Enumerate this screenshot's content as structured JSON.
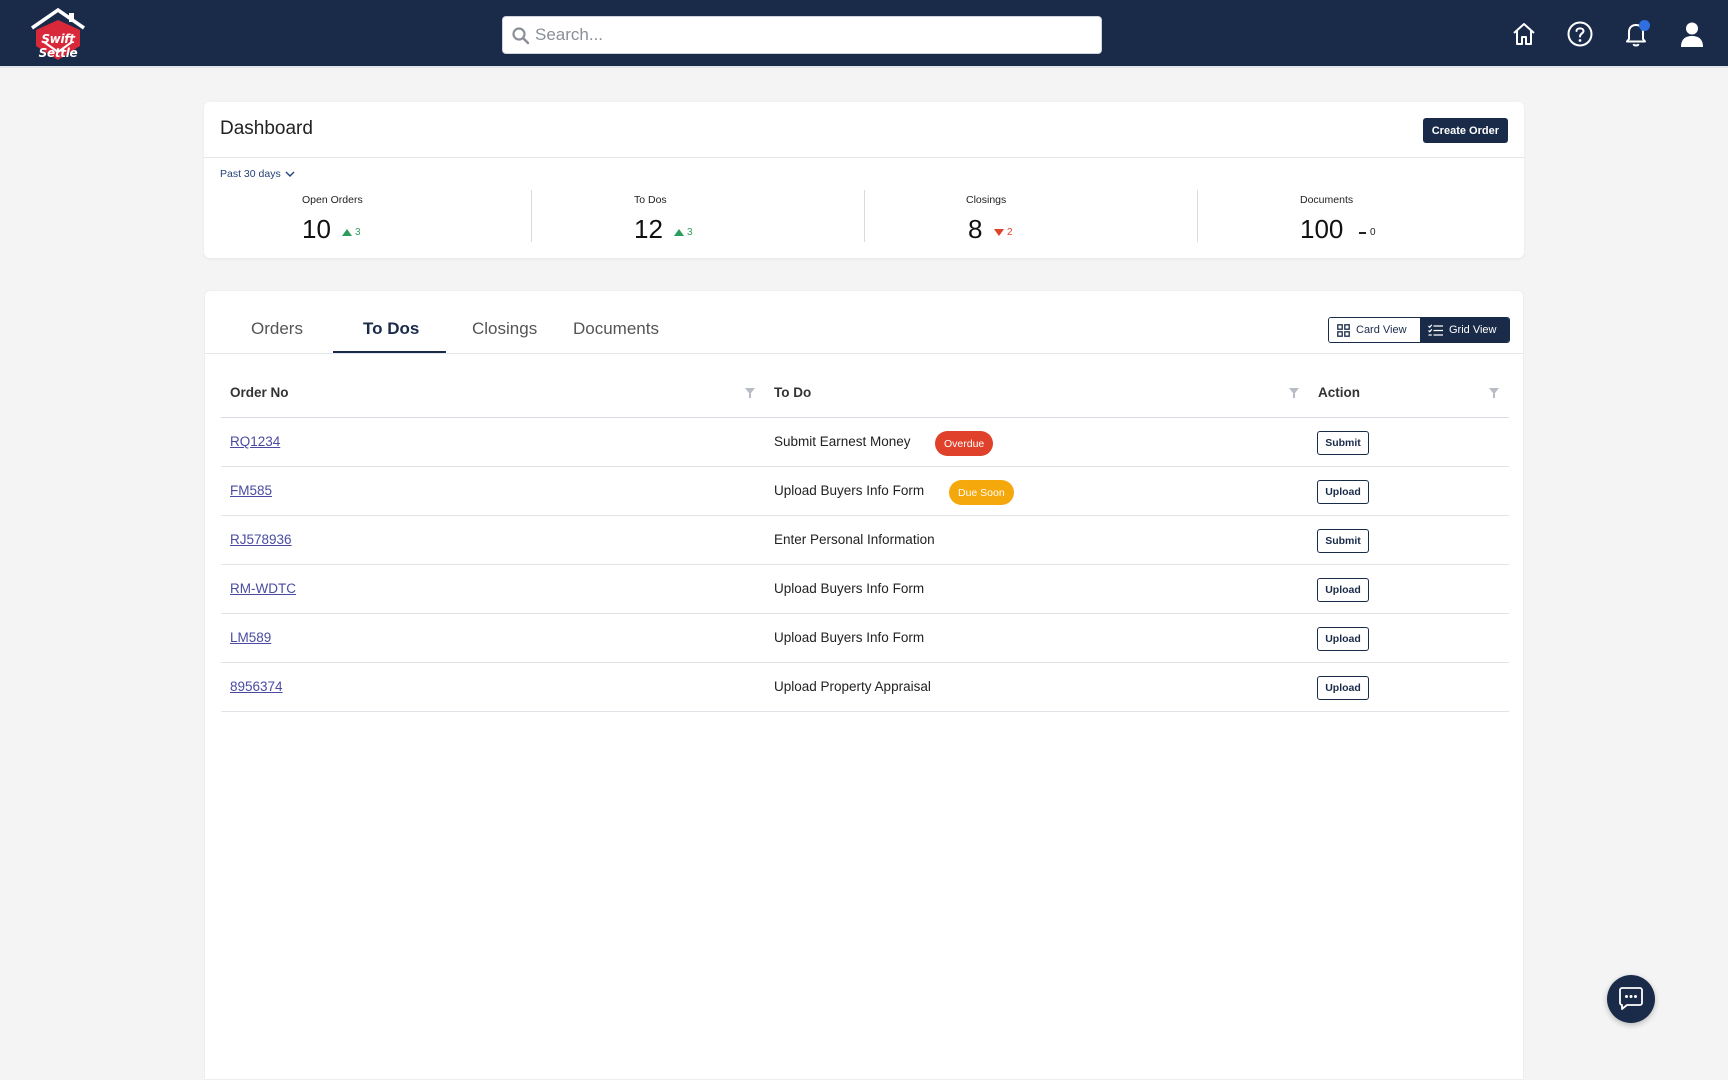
{
  "brand": {
    "name": "Swift Settle",
    "navy": "#1a2b4a",
    "accent_red": "#d8283a"
  },
  "header": {
    "search_placeholder": "Search...",
    "icons": [
      "home-icon",
      "help-icon",
      "bell-icon",
      "user-icon"
    ],
    "has_notification": true
  },
  "summary": {
    "title": "Dashboard",
    "create_label": "Create Order",
    "period_label": "Past 30 days",
    "stats": [
      {
        "label": "Open Orders",
        "value": "10",
        "delta": "3",
        "trend": "up"
      },
      {
        "label": "To Dos",
        "value": "12",
        "delta": "3",
        "trend": "up"
      },
      {
        "label": "Closings",
        "value": "8",
        "delta": "2",
        "trend": "down"
      },
      {
        "label": "Documents",
        "value": "100",
        "delta": "0",
        "trend": "flat"
      }
    ]
  },
  "tabs": [
    {
      "label": "Orders"
    },
    {
      "label": "To Dos",
      "active": true
    },
    {
      "label": "Closings"
    },
    {
      "label": "Documents"
    }
  ],
  "views": {
    "card_label": "Card View",
    "grid_label": "Grid View",
    "selected": "Grid View"
  },
  "table": {
    "columns": [
      "Order No",
      "To Do",
      "Action"
    ],
    "rows": [
      {
        "order": "RQ1234",
        "todo": "Submit Earnest Money",
        "badge": "Overdue",
        "action": "Submit"
      },
      {
        "order": "FM585",
        "todo": "Upload Buyers Info Form",
        "badge": "Due Soon",
        "action": "Upload"
      },
      {
        "order": "RJ578936",
        "todo": "Enter Personal Information",
        "badge": "",
        "action": "Submit"
      },
      {
        "order": "RM-WDTC",
        "todo": "Upload Buyers Info Form",
        "badge": "",
        "action": "Upload"
      },
      {
        "order": "LM589",
        "todo": "Upload Buyers Info Form",
        "badge": "",
        "action": "Upload"
      },
      {
        "order": "8956374",
        "todo": "Upload Property Appraisal",
        "badge": "",
        "action": "Upload"
      }
    ]
  }
}
